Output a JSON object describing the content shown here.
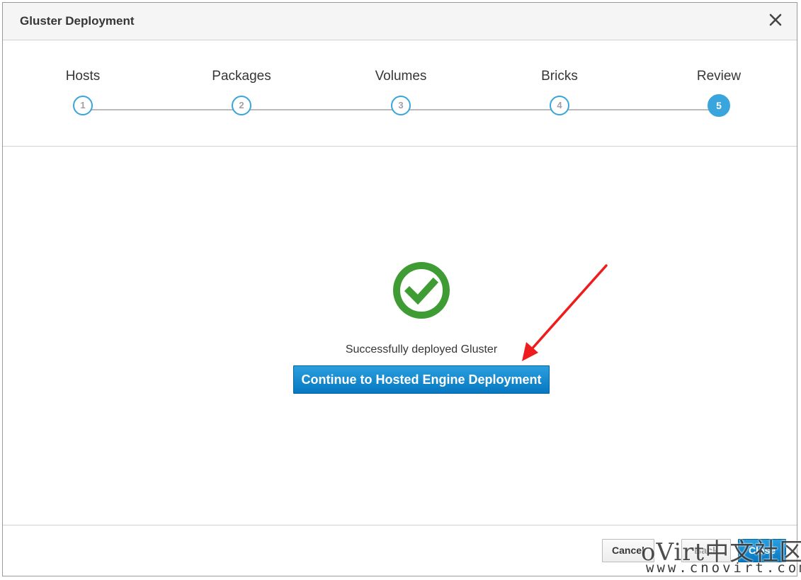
{
  "dialog": {
    "title": "Gluster Deployment"
  },
  "wizard": {
    "steps": [
      {
        "label": "Hosts",
        "number": "1"
      },
      {
        "label": "Packages",
        "number": "2"
      },
      {
        "label": "Volumes",
        "number": "3"
      },
      {
        "label": "Bricks",
        "number": "4"
      },
      {
        "label": "Review",
        "number": "5"
      }
    ],
    "active_step": 5
  },
  "content": {
    "success_icon": "check-circle-icon",
    "message": "Successfully deployed Gluster",
    "continue_label": "Continue to Hosted Engine Deployment"
  },
  "footer": {
    "cancel_label": "Cancel",
    "back_label": "Back",
    "close_label": "Close"
  },
  "watermark": {
    "main": "oVirt中文社区",
    "sub": "www.cnovirt.com"
  },
  "colors": {
    "accent": "#39a5dc",
    "primary_button": "#0778c1",
    "success": "#3f9c35",
    "annotation_arrow": "#ee1c1c"
  }
}
